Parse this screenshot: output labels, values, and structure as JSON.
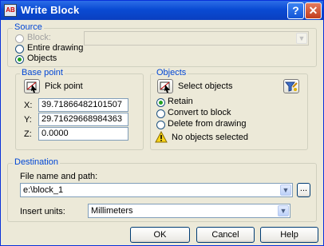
{
  "window": {
    "title": "Write Block",
    "app_icon_text": "AB",
    "help_glyph": "?",
    "close_glyph": "✕"
  },
  "source": {
    "label": "Source",
    "block_label": "Block:",
    "entire_drawing_label": "Entire drawing",
    "objects_label": "Objects",
    "selected": "Objects"
  },
  "base_point": {
    "label": "Base point",
    "pick_point_label": "Pick point",
    "x_label": "X:",
    "x_value": "39.71866482101507",
    "y_label": "Y:",
    "y_value": "29.71629668984363",
    "z_label": "Z:",
    "z_value": "0.0000"
  },
  "objects": {
    "label": "Objects",
    "select_objects_label": "Select objects",
    "retain_label": "Retain",
    "convert_label": "Convert to block",
    "delete_label": "Delete from drawing",
    "selected": "Retain",
    "warning_text": "No objects selected"
  },
  "destination": {
    "label": "Destination",
    "file_label": "File name and path:",
    "file_value": "e:\\block_1",
    "browse_label": "...",
    "units_label": "Insert units:",
    "units_value": "Millimeters"
  },
  "buttons": {
    "ok": "OK",
    "cancel": "Cancel",
    "help": "Help"
  },
  "colors": {
    "title_bar": "#0a4bd3",
    "group_label": "#0046d5",
    "dialog_bg": "#ece9d8",
    "radio_dot": "#21a121"
  }
}
